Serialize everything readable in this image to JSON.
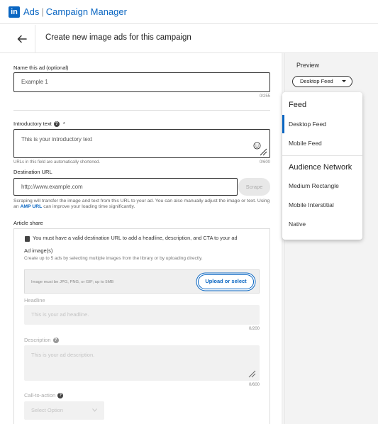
{
  "app": {
    "logo_text": "in",
    "product": "Ads",
    "section": "Campaign Manager",
    "accent_color": "#0a66c2"
  },
  "header": {
    "back_icon": "arrow-left-icon",
    "title": "Create new image ads for this campaign"
  },
  "form": {
    "ad_name": {
      "label": "Name this ad (optional)",
      "value": "Example 1",
      "counter": "0/255"
    },
    "intro_text": {
      "label": "Introductory text",
      "required_marker": "*",
      "placeholder": "This is your introductory text",
      "hint": "URLs in this field are automatically shortened.",
      "counter": "0/600"
    },
    "destination_url": {
      "label": "Destination URL",
      "placeholder": "http://www.example.com",
      "scrape_label": "Scrape",
      "desc_part1": "Scraping will transfer the image and text from this URL to your ad. You can also manually adjust the image or text. Using an",
      "desc_link": "AMP URL",
      "desc_part2": "can improve your loading time significantly."
    },
    "article_share": {
      "label": "Article share",
      "warning": "You must have a valid destination URL to add a headline, description, and CTA to your ad",
      "ad_images_label": "Ad image(s)",
      "ad_images_desc": "Create up to 5 ads by selecting multiple images from the library or by uploading directly.",
      "upload_hint": "Image must be JPG, PNG, or GIF; up to 5MB",
      "upload_button": "Upload or select",
      "headline_label": "Headline",
      "headline_placeholder": "This is your ad headline.",
      "headline_counter": "0/200",
      "description_label": "Description",
      "description_placeholder": "This is your ad description.",
      "description_counter": "0/600",
      "cta_label": "Call-to-action",
      "cta_placeholder": "Select Option"
    }
  },
  "preview": {
    "label": "Preview",
    "selected": "Desktop Feed",
    "dropdown": {
      "group1": "Feed",
      "group1_items": [
        "Desktop Feed",
        "Mobile Feed"
      ],
      "group2": "Audience Network",
      "group2_items": [
        "Medium Rectangle",
        "Mobile Interstitial",
        "Native"
      ]
    }
  }
}
